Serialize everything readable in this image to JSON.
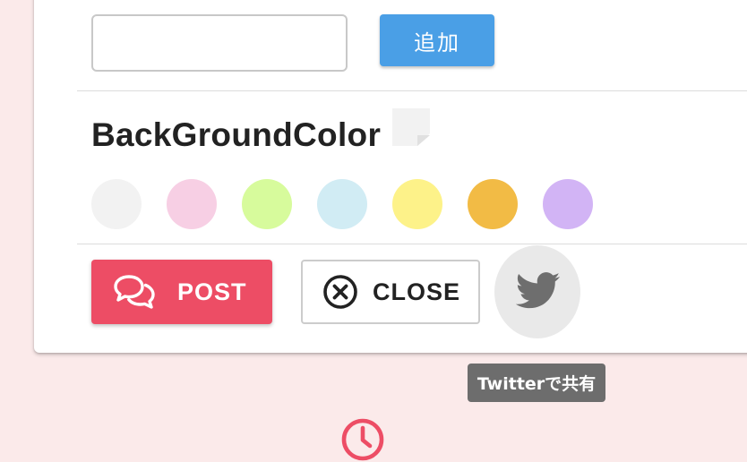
{
  "tag_form": {
    "input_value": "",
    "input_placeholder": "",
    "add_label": "追加"
  },
  "background_color": {
    "title": "BackGroundColor",
    "selected": "#f2f2f2",
    "swatches": [
      {
        "color": "#f2f2f2"
      },
      {
        "color": "#f7cfe4"
      },
      {
        "color": "#d7fb9c"
      },
      {
        "color": "#d1ecf4"
      },
      {
        "color": "#fdf289"
      },
      {
        "color": "#f2bb45"
      },
      {
        "color": "#d2b4f5"
      }
    ]
  },
  "actions": {
    "post_label": "POST",
    "post_icon": "chat-bubbles-icon",
    "close_label": "CLOSE",
    "close_icon": "close-circle-icon",
    "twitter_icon": "twitter-bird-icon",
    "twitter_tooltip": "Twitterで共有"
  },
  "footer": {
    "icon": "clock-icon"
  },
  "colors": {
    "page_background": "#fbeaea",
    "add_button": "#4a9fe6",
    "post_button": "#ed4d65",
    "tooltip": "#6d6d6d",
    "accent": "#ed4d65"
  }
}
